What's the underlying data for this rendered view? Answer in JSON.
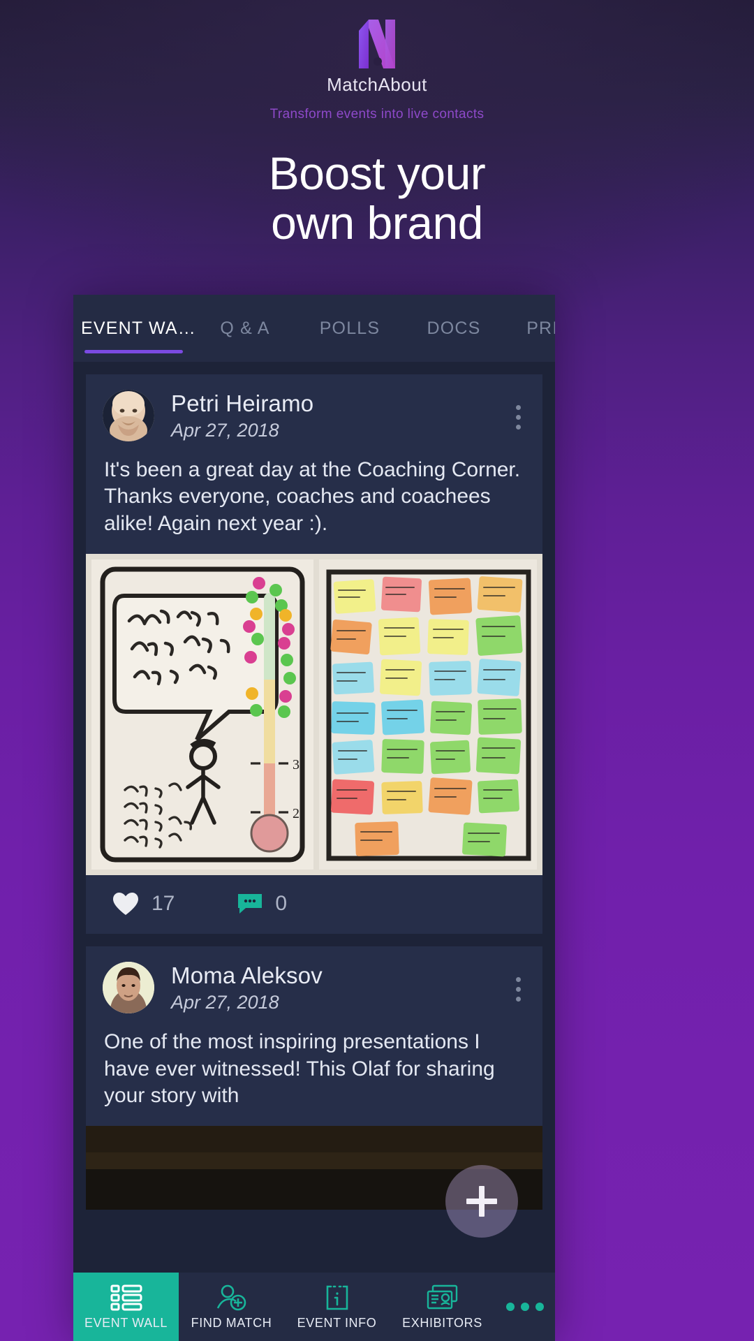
{
  "hero": {
    "logo_icon": "matchabout-m-logo",
    "brand": "MatchAbout",
    "tagline": "Transform events into live contacts",
    "headline_line1": "Boost your",
    "headline_line2": "own brand"
  },
  "tabs": [
    {
      "label": "EVENT WA…",
      "active": true
    },
    {
      "label": "Q & A",
      "active": false
    },
    {
      "label": "POLLS",
      "active": false
    },
    {
      "label": "DOCS",
      "active": false
    },
    {
      "label": "PRIZE",
      "active": false
    }
  ],
  "feed": {
    "posts": [
      {
        "author": "Petri Heiramo",
        "date": "Apr 27, 2018",
        "text": "It's been a great day at the Coaching Corner. Thanks everyone, coaches and coachees alike! Again next year :).",
        "has_media": true,
        "media_alt": "Flipchart photo: thermometer feedback poster and wall of sticky notes",
        "likes": "17",
        "comments": "0",
        "menu_icon": "kebab-menu-icon"
      },
      {
        "author": "Moma Aleksov",
        "date": "Apr 27, 2018",
        "text": "One of the most inspiring presentations I have ever witnessed! This Olaf for sharing your story with",
        "has_media": true,
        "media_alt": "Dark stage photo",
        "menu_icon": "kebab-menu-icon"
      }
    ],
    "compose_label": "+"
  },
  "bottom_nav": [
    {
      "label": "EVENT WALL",
      "icon": "grid-list-icon",
      "active": true
    },
    {
      "label": "FIND MATCH",
      "icon": "person-add-icon",
      "active": false
    },
    {
      "label": "EVENT INFO",
      "icon": "info-card-icon",
      "active": false
    },
    {
      "label": "EXHIBITORS",
      "icon": "exhibitor-cards-icon",
      "active": false
    },
    {
      "label": "",
      "icon": "more-dots-icon",
      "active": false
    }
  ],
  "colors": {
    "brand_purple": "#7b4ae2",
    "accent_teal": "#18b59a",
    "app_bg": "#1d2338",
    "card_bg": "#262e49",
    "bar_bg": "#242b44"
  }
}
